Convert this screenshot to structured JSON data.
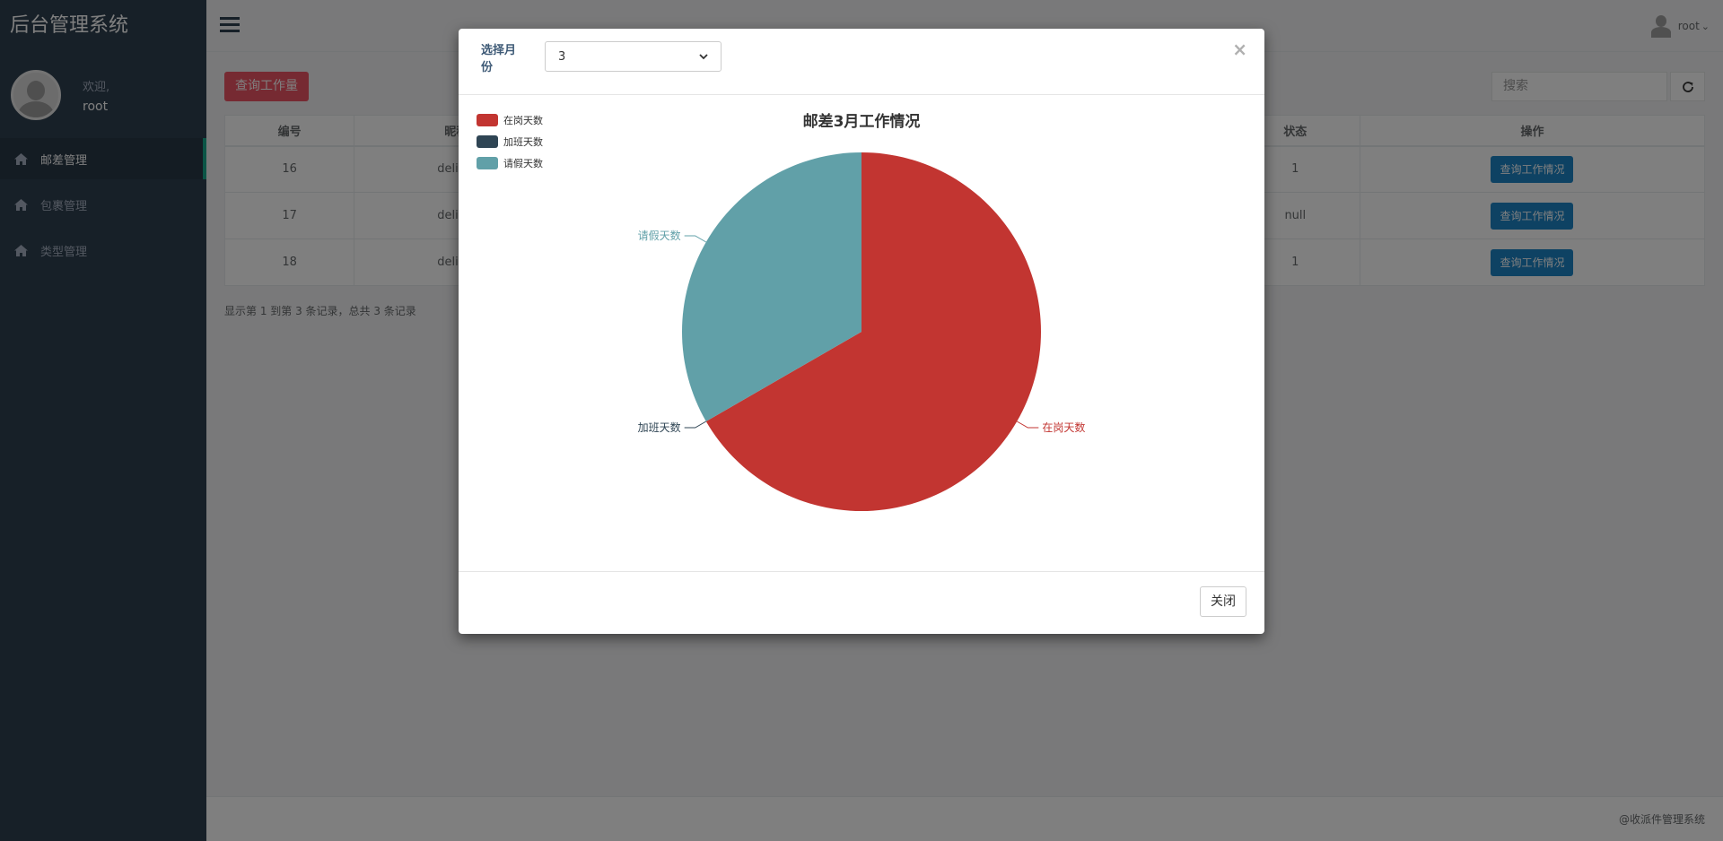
{
  "app": {
    "brand": "后台管理系统"
  },
  "profile": {
    "welcome": "欢迎,",
    "username": "root"
  },
  "sidebar": {
    "items": [
      {
        "label": "邮差管理",
        "icon": "home-icon",
        "active": true
      },
      {
        "label": "包裹管理",
        "icon": "home-icon",
        "active": false
      },
      {
        "label": "类型管理",
        "icon": "home-icon",
        "active": false
      }
    ]
  },
  "topbar": {
    "user": "root",
    "caret": "⌄"
  },
  "toolbar": {
    "query_label": "查询工作量",
    "search_placeholder": "搜索"
  },
  "table": {
    "headers": [
      "编号",
      "昵称",
      "状态",
      "操作"
    ],
    "rows": [
      {
        "id": "16",
        "name": "deliver",
        "status": "1",
        "action": "查询工作情况"
      },
      {
        "id": "17",
        "name": "delivere",
        "status": "null",
        "action": "查询工作情况"
      },
      {
        "id": "18",
        "name": "delivere",
        "status": "1",
        "action": "查询工作情况"
      }
    ]
  },
  "pager_info": "显示第 1 到第 3 条记录，总共 3 条记录",
  "footer": "@收派件管理系统",
  "modal": {
    "month_label": "选择月份",
    "month_value": "3",
    "close_x": "×",
    "close_button": "关闭"
  },
  "chart_data": {
    "type": "pie",
    "title": "邮差3月工作情况",
    "legend_position": "top-left",
    "slices": [
      {
        "name": "在岗天数",
        "value": 2,
        "color": "#c23531"
      },
      {
        "name": "加班天数",
        "value": 0,
        "color": "#2f4554"
      },
      {
        "name": "请假天数",
        "value": 1,
        "color": "#61a0a8"
      }
    ]
  }
}
